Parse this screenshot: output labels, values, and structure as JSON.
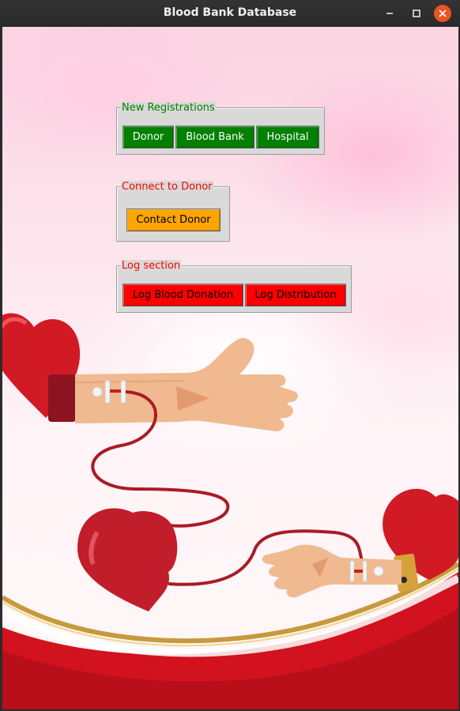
{
  "window": {
    "title": "Blood Bank Database"
  },
  "colors": {
    "registration_green": "#008000",
    "contact_orange": "#ffa500",
    "log_red": "#ff0000",
    "legend_green": "#008000",
    "legend_red": "#ff0000"
  },
  "new_registrations": {
    "legend": "New Registrations",
    "buttons": [
      "Donor",
      "Blood Bank",
      "Hospital"
    ]
  },
  "connect_to_donor": {
    "legend": "Connect to Donor",
    "buttons": [
      "Contact Donor"
    ]
  },
  "log_section": {
    "legend": "Log section",
    "buttons": [
      "Log Blood Donation",
      "Log Distribution"
    ]
  }
}
